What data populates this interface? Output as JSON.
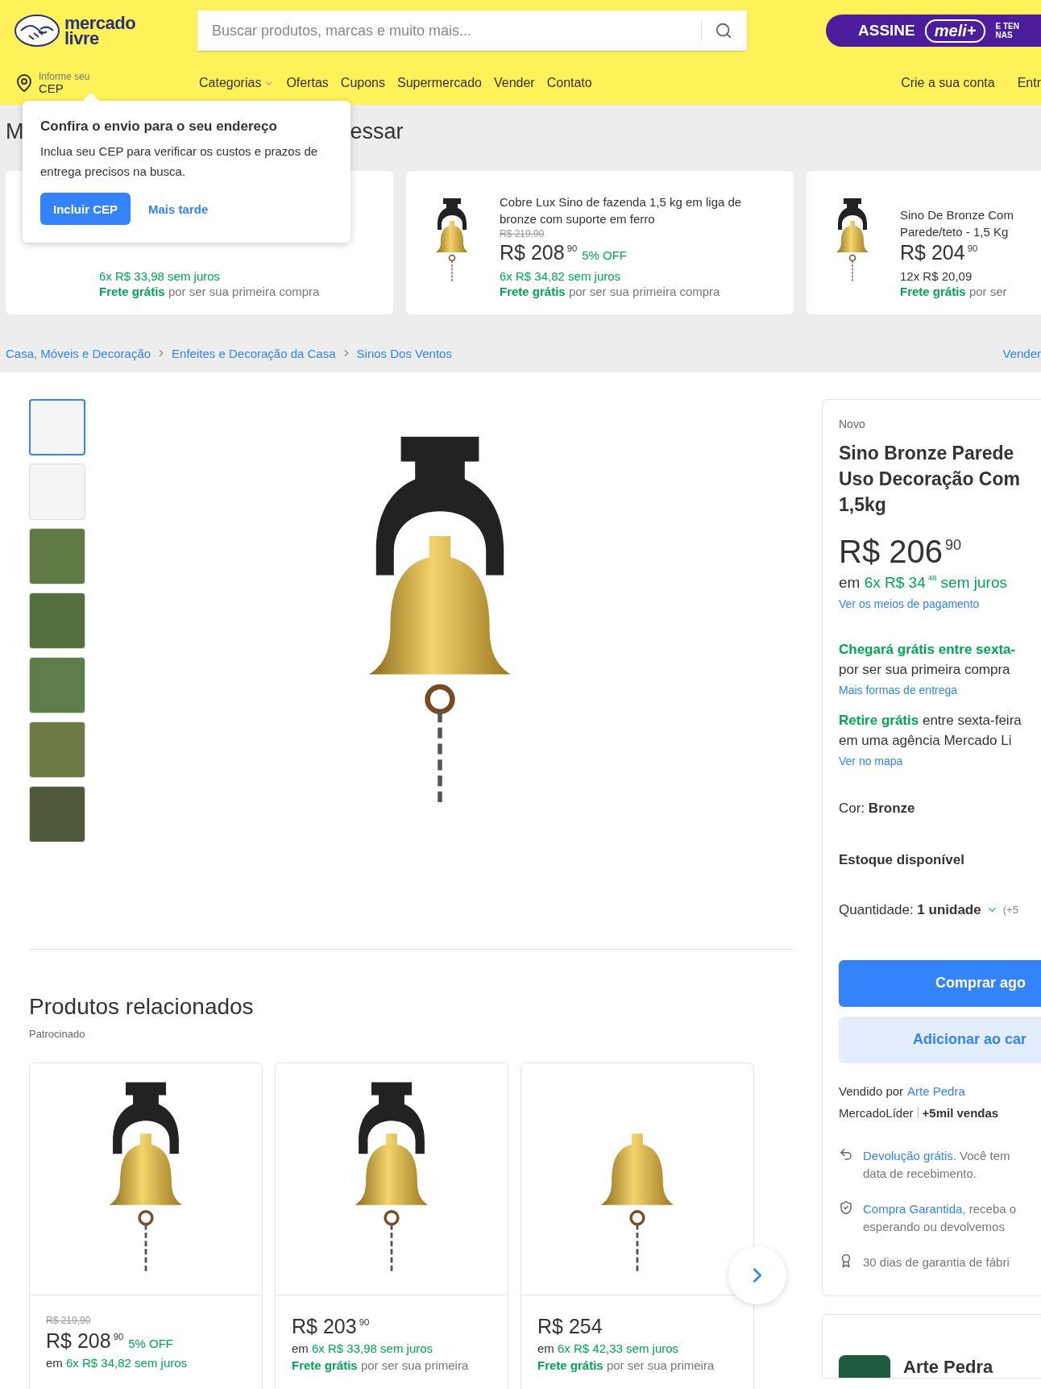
{
  "header": {
    "logo": {
      "line1": "mercado",
      "line2": "livre"
    },
    "search": {
      "placeholder": "Buscar produtos, marcas e muito mais..."
    },
    "promo": {
      "label": "ASSINE",
      "brand": "meli+",
      "note_lines": [
        "E TEN",
        "NAS"
      ]
    },
    "location": {
      "line1": "Informe seu",
      "line2": "CEP"
    },
    "nav": [
      {
        "label": "Categorias",
        "kind": "dropdown"
      },
      {
        "label": "Ofertas",
        "kind": "link"
      },
      {
        "label": "Cupons",
        "kind": "link"
      },
      {
        "label": "Supermercado",
        "kind": "link"
      },
      {
        "label": "Vender",
        "kind": "link"
      },
      {
        "label": "Contato",
        "kind": "link"
      }
    ],
    "account": [
      "Crie a sua conta",
      "Entr"
    ]
  },
  "popover": {
    "title": "Confira o envio para o seu endereço",
    "text": "Inclua seu CEP para verificar os custos e prazos de entrega precisos na busca.",
    "primary": "Incluir CEP",
    "secondary": "Mais tarde"
  },
  "recent": {
    "heading_parts": [
      "M",
      "essar"
    ],
    "cards": [
      {
        "installment": "6x R$ 33,98 sem juros",
        "interest_free": true,
        "free_label": "Frete grátis",
        "free_text": "por ser sua primeira compra"
      },
      {
        "title_lines": [
          "Cobre Lux Sino de fazenda 1,5 kg em liga de",
          "bronze com suporte em ferro"
        ],
        "old_price": "R$ 219,90",
        "price": "R$ 208$^{90}$",
        "discount": "5% OFF",
        "installment": "6x R$ 34,82 sem juros",
        "interest_free": true,
        "free_label": "Frete grátis",
        "free_text": "por ser sua primeira compra"
      },
      {
        "title_lines": [
          "Sino De Bronze Com",
          "Parede/teto - 1,5 Kg"
        ],
        "price": "R$ 204$^{90}$",
        "installment": "12x R$ 20,09",
        "interest_free": false,
        "free_label": "Frete grátis",
        "free_text": "por ser"
      }
    ]
  },
  "breadcrumb": {
    "items": [
      "Casa, Móveis e Decoração",
      "Enfeites e Decoração da Casa",
      "Sinos Dos Ventos"
    ],
    "sell_link": "Vender"
  },
  "gallery": {
    "thumbnails": [
      {
        "selected": true
      },
      {
        "selected": false
      },
      {
        "selected": false
      },
      {
        "selected": false
      },
      {
        "selected": false
      },
      {
        "selected": false
      },
      {
        "selected": false
      }
    ]
  },
  "product": {
    "condition": "Novo",
    "title_lines": [
      "Sino Bronze Parede",
      "Uso Decoração Com",
      "1,5kg"
    ],
    "price": "R$ 206$^{90}$",
    "installment_prefix": "em",
    "installment": "6x R$ 34$^{48}$ sem juros",
    "payment_link": "Ver os meios de pagamento",
    "shipping_title": "Chegará grátis entre sexta-",
    "shipping_text": "por ser sua primeira compra",
    "shipping_link": "Mais formas de entrega",
    "pickup_lines": [
      "**Retire grátis** entre sexta-feira",
      "em uma agência Mercado Li"
    ],
    "pickup_link": "Ver no mapa",
    "variant_label": "Cor:",
    "variant_value": "Bronze",
    "stock": "Estoque disponível",
    "quantity": "Quantidade: **1 unidade**",
    "quantity_note": "(+5",
    "buy_button": "Comprar ago",
    "cart_button": "Adicionar ao car",
    "seller_prefix": "Vendido por",
    "seller_link": "Arte Pedra",
    "seller_badge": "MercadoLíder",
    "seller_sales": "+5mil vendas",
    "benefits": [
      {
        "kind": "return",
        "link": "Devolução grátis.",
        "lines": [
          " Você tem",
          "data de recebimento."
        ]
      },
      {
        "kind": "shield",
        "link": "Compra Garantida",
        "lines": [
          ", receba o",
          "esperando ou devolvemos"
        ]
      },
      {
        "kind": "award",
        "lines": [
          "30 dias de garantia de fábri"
        ]
      }
    ],
    "seller_card": {
      "name": "Arte Pedra"
    }
  },
  "related": {
    "title": "Produtos relacionados",
    "subtitle": "Patrocinado",
    "cards": [
      {
        "old_price": "R$ 219,90",
        "price": "R$ 208$^{90}$",
        "discount": "5% OFF",
        "installment_prefix": "em",
        "installment": "6x R$ 34,82 sem juros"
      },
      {
        "price": "R$ 203$^{90}$",
        "installment_prefix": "em",
        "installment": "6x R$ 33,98 sem juros",
        "free_label": "Frete grátis",
        "free_text": "por ser sua primeira"
      },
      {
        "price": "R$ 254",
        "installment_prefix": "em",
        "installment": "6x R$ 42,33 sem juros",
        "free_label": "Frete grátis",
        "free_text": "por ser sua primeira"
      }
    ]
  }
}
